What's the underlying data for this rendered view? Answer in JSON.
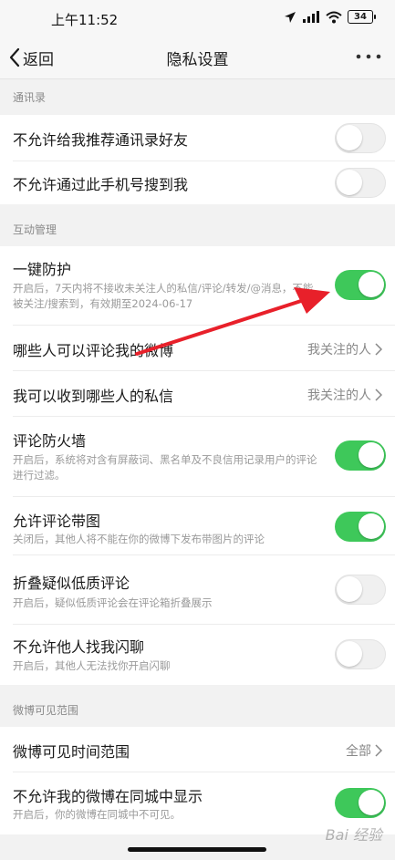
{
  "status_bar": {
    "time": "上午11:52",
    "battery": "34"
  },
  "nav": {
    "back_label": "返回",
    "title": "隐私设置"
  },
  "sections": {
    "contacts": "通讯录",
    "interaction": "互动管理",
    "visibility": "微博可见范围"
  },
  "rows": {
    "no_recommend_contacts": {
      "label": "不允许给我推荐通讯录好友",
      "toggle": "off"
    },
    "no_phone_search": {
      "label": "不允许通过此手机号搜到我",
      "toggle": "off"
    },
    "one_key_protect": {
      "label": "一键防护",
      "desc": "开启后，7天内将不接收未关注人的私信/评论/转发/@消息，不能被关注/搜索到，有效期至2024-06-17",
      "toggle": "on"
    },
    "who_can_comment": {
      "label": "哪些人可以评论我的微博",
      "value": "我关注的人"
    },
    "who_can_message": {
      "label": "我可以收到哪些人的私信",
      "value": "我关注的人"
    },
    "comment_firewall": {
      "label": "评论防火墙",
      "desc": "开启后，系统将对含有屏蔽词、黑名单及不良信用记录用户的评论进行过滤。",
      "toggle": "on"
    },
    "comment_images": {
      "label": "允许评论带图",
      "desc": "关闭后，其他人将不能在你的微博下发布带图片的评论",
      "toggle": "on"
    },
    "fold_low_quality": {
      "label": "折叠疑似低质评论",
      "desc": "开启后，疑似低质评论会在评论箱折叠展示",
      "toggle": "off"
    },
    "no_flash_chat": {
      "label": "不允许他人找我闪聊",
      "desc": "开启后，其他人无法找你开启闪聊",
      "toggle": "off"
    },
    "visible_time_range": {
      "label": "微博可见时间范围",
      "value": "全部"
    },
    "no_same_city": {
      "label": "不允许我的微博在同城中显示",
      "desc": "开启后，你的微博在同城中不可见。",
      "toggle": "on"
    }
  },
  "watermark": "Bai 经验",
  "colors": {
    "toggle_on": "#3ec85a",
    "annotation_arrow": "#e8202a"
  }
}
